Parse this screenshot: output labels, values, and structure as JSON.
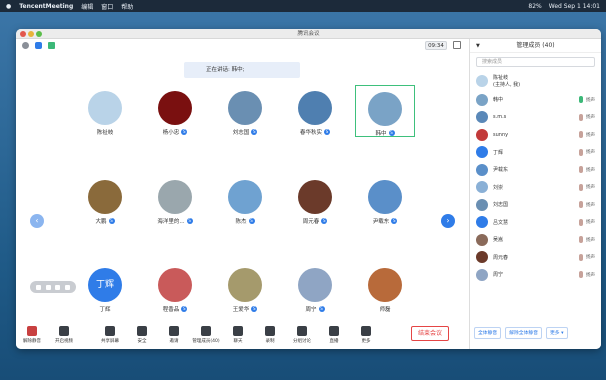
{
  "menubar": {
    "app": "TencentMeeting",
    "items": [
      "编辑",
      "窗口",
      "帮助"
    ],
    "battery": "82%",
    "clock": "Wed Sep 1  14:01"
  },
  "window": {
    "title": "腾讯会议"
  },
  "meeting": {
    "timer": "09:34",
    "speaking": "正在讲话: 韩中;"
  },
  "participants": [
    {
      "name": "陈祉岐",
      "badge": false,
      "color": "#b9d3e8"
    },
    {
      "name": "杨小忠",
      "badge": true,
      "color": "#7a1010"
    },
    {
      "name": "刘志国",
      "badge": true,
      "color": "#6a8fb2"
    },
    {
      "name": "春华秋实",
      "badge": true,
      "color": "#4f7fb0"
    },
    {
      "name": "韩中",
      "badge": true,
      "color": "#7aa3c6",
      "active": true
    },
    {
      "name": "大鹏",
      "badge": true,
      "color": "#8a6a3b"
    },
    {
      "name": "海洋里的...",
      "badge": true,
      "color": "#9aa7ad"
    },
    {
      "name": "陈杰",
      "badge": true,
      "color": "#6fa2d1"
    },
    {
      "name": "周元春",
      "badge": true,
      "color": "#6b3a2a"
    },
    {
      "name": "尹载东",
      "badge": true,
      "color": "#5a8fc9"
    },
    {
      "name": "丁辉",
      "badge": false,
      "color": "#2f7ce8",
      "initials": "丁辉"
    },
    {
      "name": "程香品",
      "badge": true,
      "color": "#c95a5a"
    },
    {
      "name": "王爱华",
      "badge": true,
      "color": "#a59a6c"
    },
    {
      "name": "周宁",
      "badge": true,
      "color": "#8fa5c4"
    },
    {
      "name": "师磊",
      "badge": false,
      "color": "#b86a3a"
    }
  ],
  "toolbar": [
    {
      "label": "解除静音",
      "icon": "mic-muted-icon"
    },
    {
      "label": "开启视频",
      "icon": "camera-off-icon"
    },
    {
      "label": "共享屏幕",
      "icon": "share-screen-icon"
    },
    {
      "label": "安全",
      "icon": "shield-icon"
    },
    {
      "label": "邀请",
      "icon": "invite-icon"
    },
    {
      "label": "管理成员(40)",
      "icon": "members-icon"
    },
    {
      "label": "聊天",
      "icon": "chat-icon"
    },
    {
      "label": "录制",
      "icon": "record-icon"
    },
    {
      "label": "分组讨论",
      "icon": "breakout-icon"
    },
    {
      "label": "直播",
      "icon": "live-icon"
    },
    {
      "label": "更多",
      "icon": "more-icon"
    }
  ],
  "end_button": "结束会议",
  "sidebar": {
    "title": "管理成员 (40)",
    "search_placeholder": "搜索成员",
    "members": [
      {
        "name": "陈祉岐\n(主持人, 我)",
        "mic": false,
        "video": "",
        "color": "#b9d3e8"
      },
      {
        "name": "韩中",
        "mic": true,
        "video": "扬声",
        "color": "#7aa3c6"
      },
      {
        "name": "s.m.s",
        "mic": false,
        "video": "扬声",
        "color": "#5a88b8"
      },
      {
        "name": "sunny",
        "mic": false,
        "video": "扬声",
        "color": "#c23a3a"
      },
      {
        "name": "丁辉",
        "mic": false,
        "video": "扬声",
        "color": "#2f7ce8"
      },
      {
        "name": "尹载东",
        "mic": false,
        "video": "扬声",
        "color": "#5a8fc9"
      },
      {
        "name": "刘崇",
        "mic": false,
        "video": "扬声",
        "color": "#8ab0d6"
      },
      {
        "name": "刘志国",
        "mic": false,
        "video": "扬声",
        "color": "#6a8fb2"
      },
      {
        "name": "吕文慧",
        "mic": false,
        "video": "扬声",
        "color": "#2f7ce8"
      },
      {
        "name": "吴嵩",
        "mic": false,
        "video": "扬声",
        "color": "#8a6a5a"
      },
      {
        "name": "周元春",
        "mic": false,
        "video": "扬声",
        "color": "#6b3a2a"
      },
      {
        "name": "周宁",
        "mic": false,
        "video": "扬声",
        "color": "#8fa5c4"
      }
    ],
    "buttons": [
      "全体静音",
      "解除全体静音",
      "更多 ▾"
    ]
  }
}
